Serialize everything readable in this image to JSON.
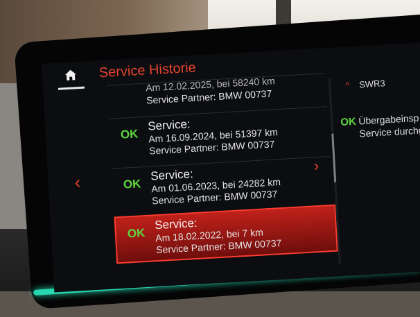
{
  "header": {
    "title": "Service Historie"
  },
  "radio": {
    "station": "SWR3"
  },
  "side_panel": {
    "status": "OK",
    "line1": "Übergabeinsp.",
    "line2": "Service durchge"
  },
  "list": {
    "items": [
      {
        "status": "",
        "title": "",
        "line1": "Am 12.02.2025, bei 58240 km",
        "line2": "Service Partner: BMW 00737"
      },
      {
        "status": "OK",
        "title": "Service:",
        "line1": "Am 16.09.2024, bei 51397 km",
        "line2": "Service Partner: BMW 00737"
      },
      {
        "status": "OK",
        "title": "Service:",
        "line1": "Am 01.06.2023, bei 24282 km",
        "line2": "Service Partner: BMW 00737"
      },
      {
        "status": "OK",
        "title": "Service:",
        "line1": "Am 18.02.2022, bei 7 km",
        "line2": "Service Partner: BMW 00737"
      }
    ]
  },
  "nav": {
    "prev": "‹",
    "next": "›"
  },
  "icons": {
    "home": "home-icon",
    "up": "chevron-up-icon"
  },
  "colors": {
    "accent": "#e8432d",
    "ok": "#5fd640",
    "selected": "#c0211a",
    "ambient": "#27d7b0"
  }
}
